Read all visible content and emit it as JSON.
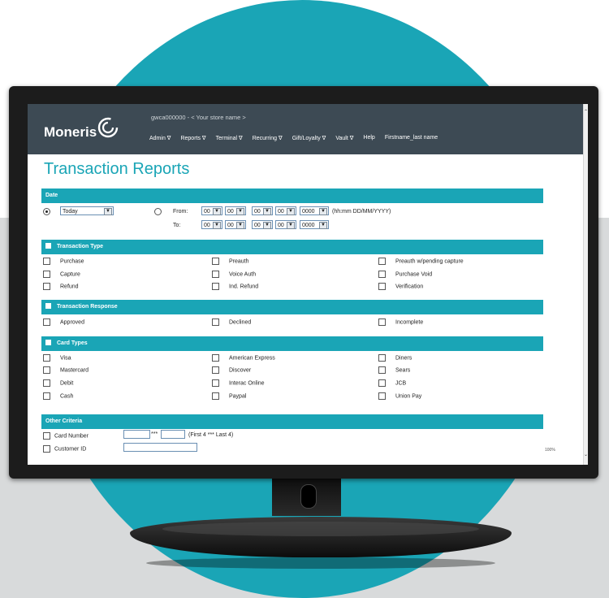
{
  "header": {
    "brand": "Moneris",
    "store": "gwca000000  -  < Your store name >",
    "nav": [
      "Admin ∇",
      "Reports ∇",
      "Terminal ∇",
      "Recurring ∇",
      "Gift/Loyalty ∇",
      "Vault ∇",
      "Help",
      "Firstname_last name"
    ]
  },
  "title": "Transaction Reports",
  "date": {
    "label": "Date",
    "preset_value": "Today",
    "from_label": "From:",
    "to_label": "To:",
    "hh": "00",
    "mm": "00",
    "dd": "00",
    "mo": "00",
    "yyyy": "0000",
    "format_hint": "(hh:mm DD/MM/YYYY)"
  },
  "transaction_type": {
    "label": "Transaction Type",
    "items": [
      "Purchase",
      "Preauth",
      "Preauth w/pending capture",
      "Capture",
      "Voice Auth",
      "Purchase Void",
      "Refund",
      "Ind. Refund",
      "Verification"
    ]
  },
  "transaction_response": {
    "label": "Transaction Response",
    "items": [
      "Approved",
      "Declined",
      "Incomplete"
    ]
  },
  "card_types": {
    "label": "Card Types",
    "items": [
      "Visa",
      "American Express",
      "Diners",
      "Mastercard",
      "Discover",
      "Sears",
      "Debit",
      "Interac Online",
      "JCB",
      "Cash",
      "Paypal",
      "Union Pay"
    ]
  },
  "other_criteria": {
    "label": "Other Criteria",
    "card_number_label": "Card Number",
    "card_mask": "***",
    "card_hint": "(First 4 *** Last 4)",
    "customer_id_label": "Customer ID"
  },
  "zoom": "100%",
  "colors": {
    "accent": "#1aa5b6",
    "header": "#3d4a54"
  }
}
